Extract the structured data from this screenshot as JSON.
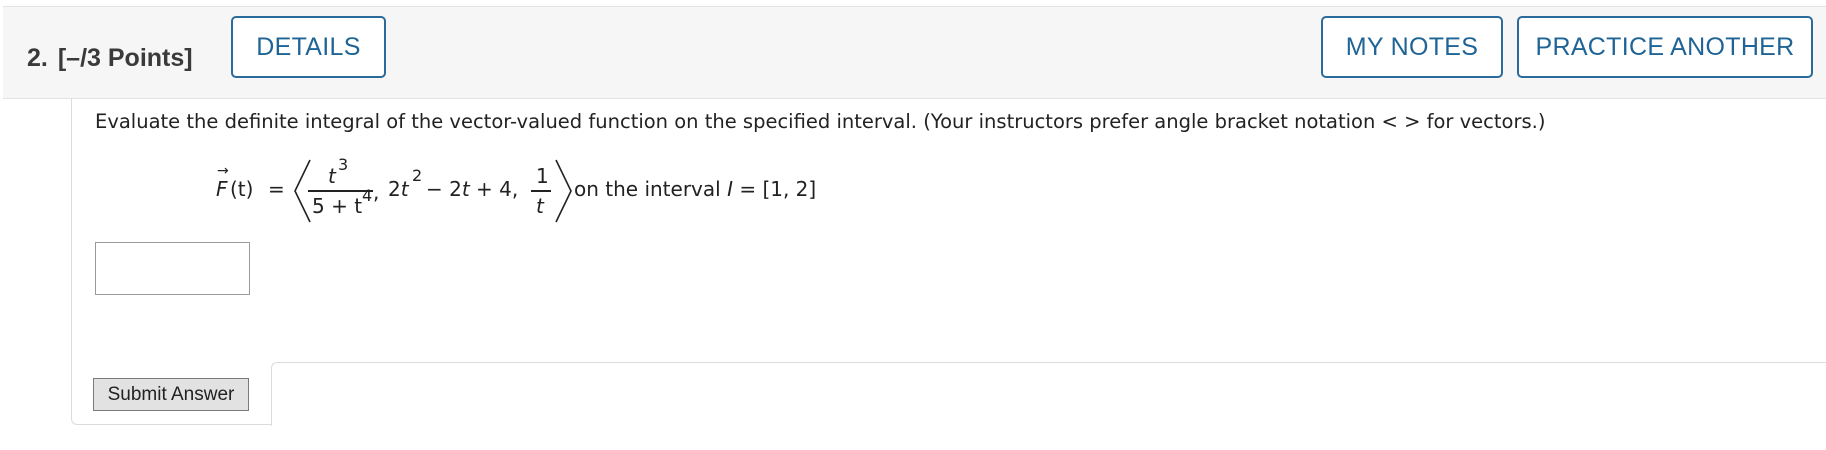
{
  "question": {
    "number": "2.",
    "points": "[–/3 Points]"
  },
  "toolbar": {
    "details_label": "DETAILS",
    "my_notes_label": "MY NOTES",
    "practice_label": "PRACTICE ANOTHER"
  },
  "colors": {
    "accent": "#1f6496",
    "header_bg": "#f6f6f6",
    "submit_bg": "#e2e2e2"
  },
  "problem": {
    "instructions": "Evaluate the definite integral of the vector-valued function on the specified interval. (Your instructors prefer angle bracket notation < > for vectors.)",
    "function_name": "F",
    "vector_arrow": "→",
    "variable": "(t)",
    "equals": "=",
    "comp1_num": "t",
    "comp1_num_exp": "3",
    "comp1_den": "5 + t",
    "comp1_den_exp": "4",
    "comma1": ",",
    "comp2_a": "2t",
    "comp2_a_exp": "2",
    "comp2_rest": "− 2t + 4,",
    "comp3_num": "1",
    "comp3_den": "t",
    "interval_text_pre": "on the interval ",
    "interval_var": "I",
    "interval_text_post": " = [1, 2]"
  },
  "answer": {
    "value": "",
    "placeholder": ""
  },
  "submit": {
    "label": "Submit Answer"
  }
}
